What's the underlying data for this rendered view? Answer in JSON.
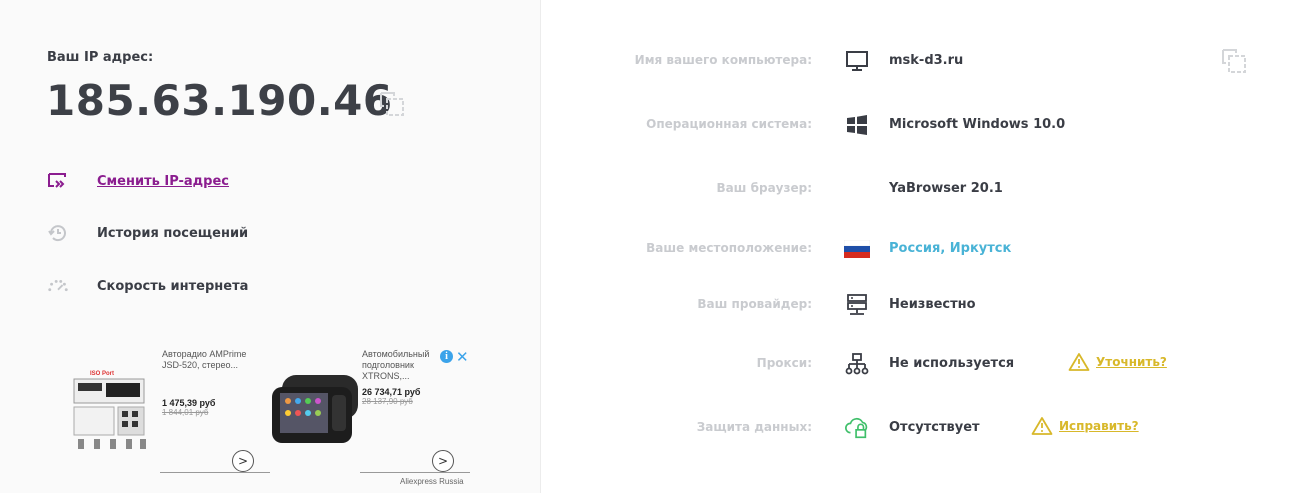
{
  "ip": {
    "label": "Ваш IP адрес:",
    "value": "185.63.190.46"
  },
  "menu": [
    {
      "label": "Сменить IP-адрес",
      "icon": "change-ip-icon"
    },
    {
      "label": "История посещений",
      "icon": "history-icon"
    },
    {
      "label": "Скорость интернета",
      "icon": "speedometer-icon"
    }
  ],
  "ads": [
    {
      "title": "Авторадио AMPrime JSD-520, стерео...",
      "price": "1 475,39 руб",
      "old_price": "1 844,01 руб",
      "image_text": "ISO Port"
    },
    {
      "title": "Автомобильный подголовник XTRONS,...",
      "price": "26 734,71 руб",
      "old_price": "28 137,90 руб"
    }
  ],
  "ad_source": "Aliexpress Russia",
  "info": {
    "computer": {
      "label": "Имя вашего компьютера:",
      "value": "msk-d3.ru"
    },
    "os": {
      "label": "Операционная система:",
      "value": "Microsoft Windows 10.0"
    },
    "browser": {
      "label": "Ваш браузер:",
      "value": "YaBrowser 20.1"
    },
    "location": {
      "label": "Ваше местоположение:",
      "value": "Россия, Иркутск"
    },
    "provider": {
      "label": "Ваш провайдер:",
      "value": "Неизвестно"
    },
    "proxy": {
      "label": "Прокси:",
      "value": "Не используется",
      "action": "Уточнить?"
    },
    "protection": {
      "label": "Защита данных:",
      "value": "Отсутствует",
      "action": "Исправить?"
    }
  },
  "colors": {
    "accent_purple": "#8b1d8f",
    "location_blue": "#49b3d6",
    "warning_yellow": "#d8b82a",
    "label_grey": "#c9cbcf",
    "lock_green": "#3fbf6a"
  }
}
